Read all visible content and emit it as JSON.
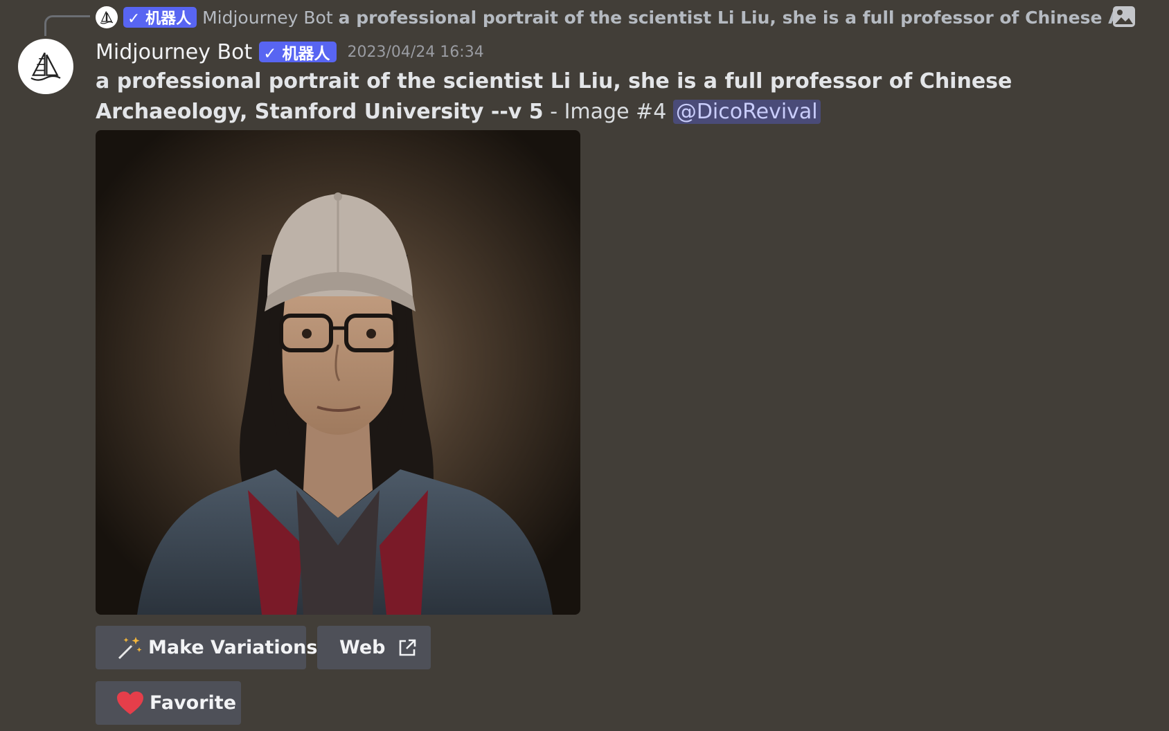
{
  "reply": {
    "bot_tag": "✓ 机器人",
    "author": "Midjourney Bot",
    "text": "a professional portrait of the scientist Li Liu, she is a full professor of Chinese Archaeolog",
    "attachment_icon": "image-icon"
  },
  "message": {
    "author": "Midjourney Bot",
    "bot_tag": "✓ 机器人",
    "timestamp": "2023/04/24 16:34",
    "prompt": "a professional portrait of the scientist Li Liu, she is a full professor of Chinese Archaeology, Stanford University --v 5",
    "separator": " - Image #4 ",
    "mention": "@DicoRevival",
    "avatar_icon": "sailboat-logo-icon"
  },
  "buttons": {
    "make_variations": "Make Variations",
    "make_variations_icon": "magic-wand-icon",
    "web": "Web",
    "web_icon": "external-link-icon",
    "favorite": "Favorite",
    "favorite_icon": "heart-icon"
  },
  "colors": {
    "background": "#423e38",
    "button": "#4e5058",
    "bot_tag": "#5865f2",
    "heart": "#e53e4a"
  }
}
